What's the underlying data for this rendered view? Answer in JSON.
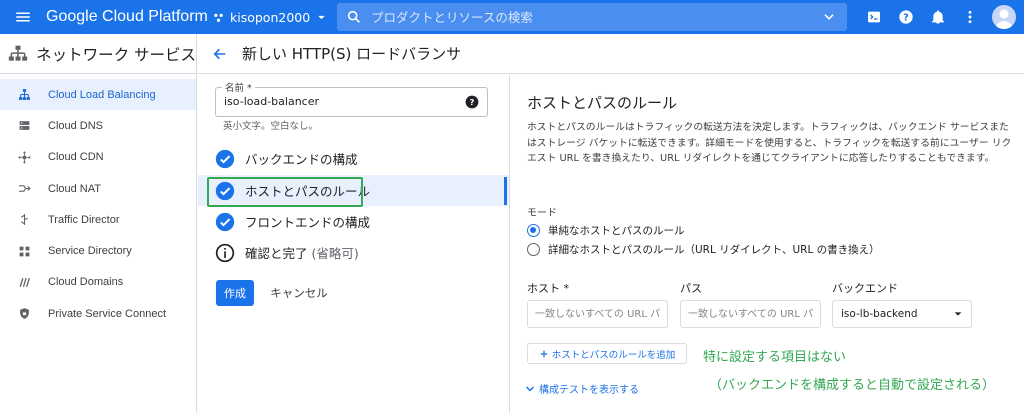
{
  "topbar": {
    "brand": "Google Cloud Platform",
    "project": "kisopon2000",
    "search_placeholder": "プロダクトとリソースの検索",
    "accent": "#1a73e8"
  },
  "sidebar": {
    "title": "ネットワーク サービス",
    "items": [
      {
        "label": "Cloud Load Balancing",
        "icon": "load-balancing-icon",
        "active": true
      },
      {
        "label": "Cloud DNS",
        "icon": "dns-icon"
      },
      {
        "label": "Cloud CDN",
        "icon": "cdn-icon"
      },
      {
        "label": "Cloud NAT",
        "icon": "nat-icon"
      },
      {
        "label": "Traffic Director",
        "icon": "traffic-director-icon"
      },
      {
        "label": "Service Directory",
        "icon": "service-directory-icon"
      },
      {
        "label": "Cloud Domains",
        "icon": "domains-icon"
      },
      {
        "label": "Private Service Connect",
        "icon": "private-service-connect-icon"
      }
    ]
  },
  "page": {
    "title": "新しい HTTP(S) ロードバランサ"
  },
  "stepper": {
    "name_label": "名前 *",
    "name_value": "iso-load-balancer",
    "name_hint": "英小文字。空白なし。",
    "steps": [
      {
        "label": "バックエンドの構成",
        "icon": "check-circle-icon"
      },
      {
        "label": "ホストとパスのルール",
        "icon": "check-circle-icon",
        "current": true
      },
      {
        "label": "フロントエンドの構成",
        "icon": "check-circle-icon"
      },
      {
        "label": "確認と完了",
        "suffix": "(省略可)",
        "icon": "info-icon"
      }
    ],
    "create_label": "作成",
    "cancel_label": "キャンセル"
  },
  "main": {
    "title": "ホストとパスのルール",
    "description": "ホストとパスのルールはトラフィックの転送方法を決定します。トラフィックは、バックエンド サービスまたはストレージ バケットに転送できます。詳細モードを使用すると、トラフィックを転送する前にユーザー リクエスト URL を書き換えたり、URL リダイレクトを通じてクライアントに応答したりすることもできます。",
    "mode_label": "モード",
    "mode_options": [
      {
        "label": "単純なホストとパスのルール",
        "selected": true
      },
      {
        "label": "詳細なホストとパスのルール（URL リダイレクト、URL の書き換え）",
        "selected": false
      }
    ],
    "host_label": "ホスト *",
    "path_label": "パス",
    "backend_label": "バックエンド",
    "host_placeholder": "一致しないすべての URL パ",
    "path_placeholder": "一致しないすべての URL パ",
    "backend_value": "iso-lb-backend",
    "add_rule_label": "ホストとパスのルールを追加",
    "show_test_label": "構成テストを表示する"
  },
  "annotation": {
    "line1": "特に設定する項目はない",
    "line2": "（バックエンドを構成すると自動で設定される）",
    "color": "#34a853"
  }
}
